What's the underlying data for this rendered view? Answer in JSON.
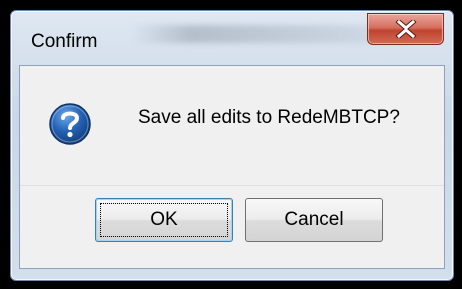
{
  "dialog": {
    "title": "Confirm",
    "message": "Save all edits to RedeMBTCP?",
    "icon": "question-icon",
    "buttons": {
      "ok_label": "OK",
      "cancel_label": "Cancel"
    },
    "close_icon": "close-icon"
  },
  "colors": {
    "close_button": "#c94a36",
    "question_icon": "#1f5fae",
    "frame": "#c9d7e6"
  }
}
